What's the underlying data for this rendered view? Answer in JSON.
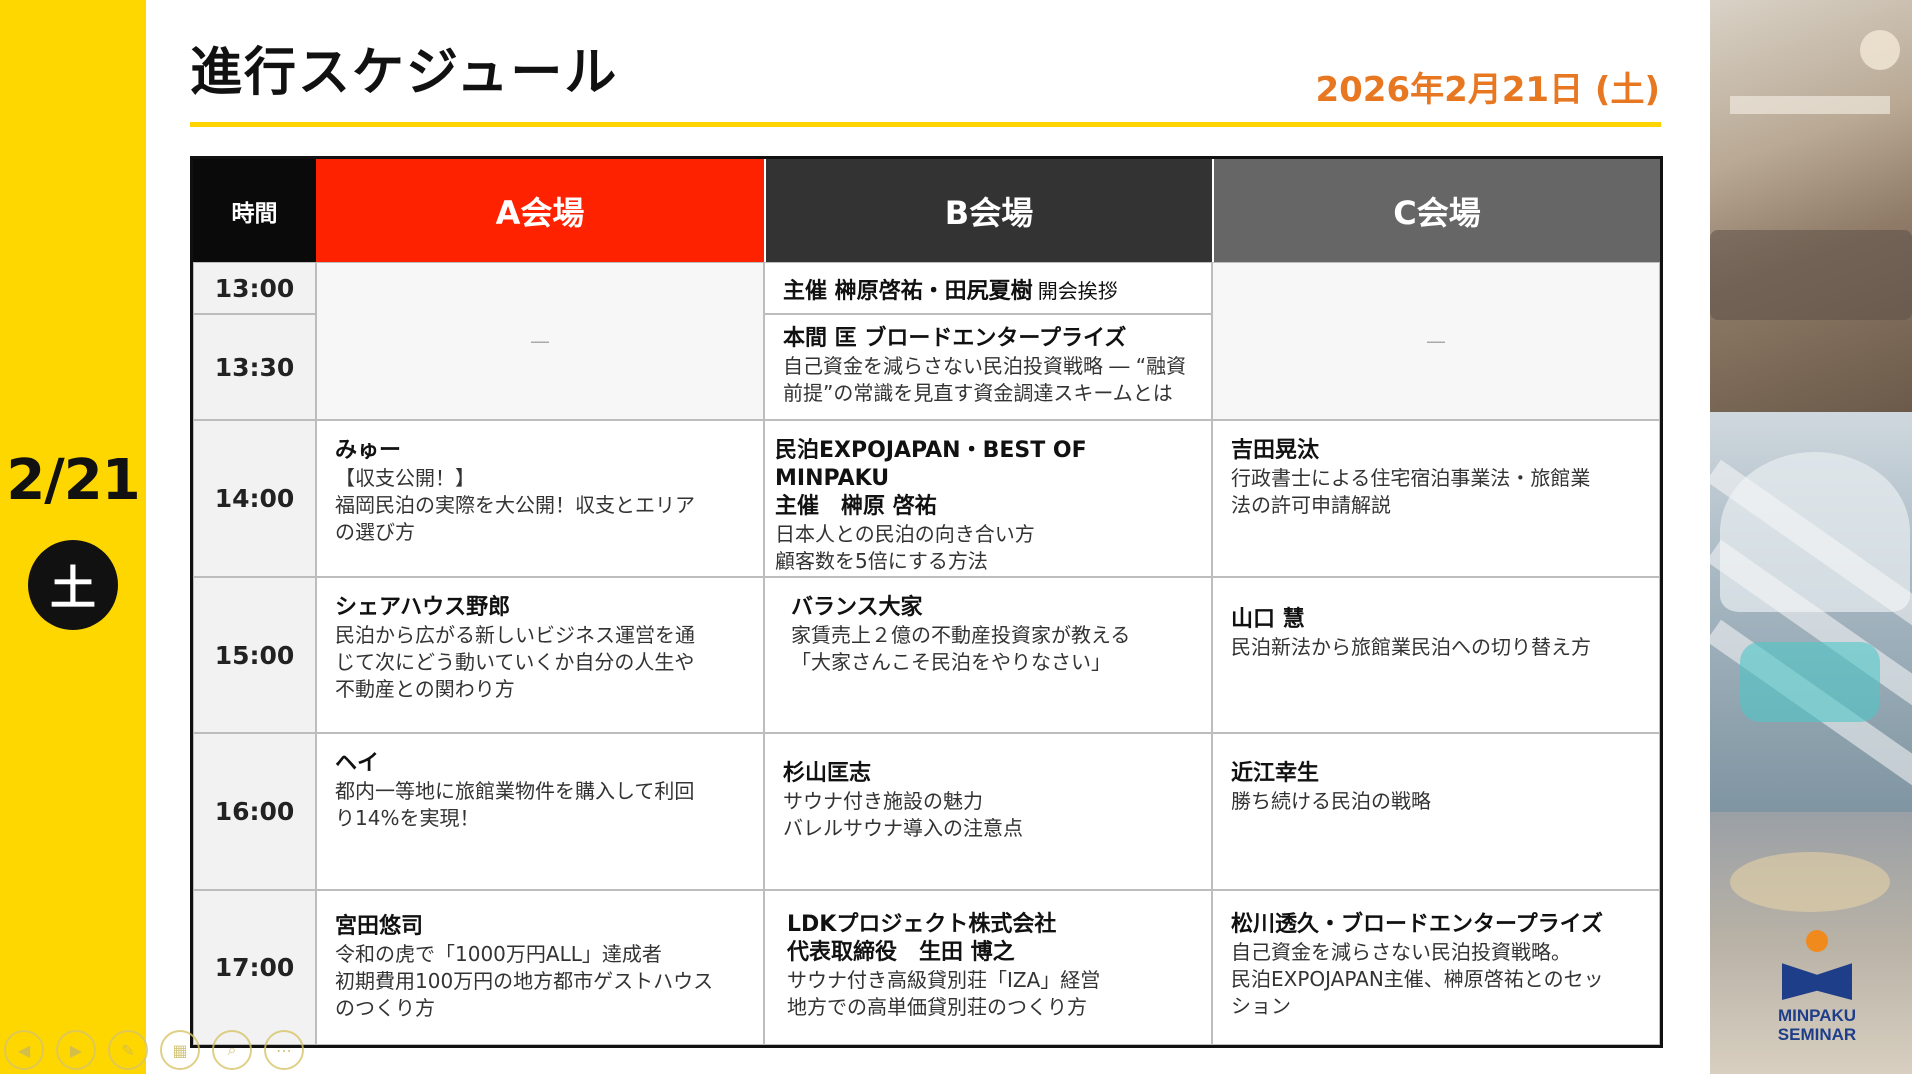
{
  "sidebar": {
    "date": "2/21",
    "day": "土"
  },
  "header": {
    "title": "進行スケジュール",
    "date": "2026年2月21日 (土)"
  },
  "table": {
    "headers": {
      "time": "時間",
      "venue_a": "A会場",
      "venue_b": "B会場",
      "venue_c": "C会場"
    },
    "times": [
      "13:00",
      "13:30",
      "14:00",
      "15:00",
      "16:00",
      "17:00"
    ],
    "empty_a": "—",
    "empty_c": "—",
    "b_1300": {
      "speaker": "主催 榊原啓祐・田尻夏樹",
      "note": "開会挨拶"
    },
    "b_1330": {
      "speaker": "本間 匡 ブロードエンタープライズ",
      "desc1": "自己資金を減らさない民泊投資戦略 ― “融資",
      "desc2": "前提”の常識を見直す資金調達スキームとは"
    },
    "row_1400": {
      "a": {
        "speaker": "みゅー",
        "desc1": "【収支公開！】",
        "desc2": "福岡民泊の実際を大公開！収支とエリア",
        "desc3": "の選び方"
      },
      "b": {
        "speaker1": "民泊EXPOJAPAN・BEST OF MINPAKU",
        "speaker2": "主催　榊原 啓祐",
        "desc1": "日本人との民泊の向き合い方",
        "desc2": "顧客数を5倍にする方法"
      },
      "c": {
        "speaker": "吉田晃汰",
        "desc1": "行政書士による住宅宿泊事業法・旅館業",
        "desc2": "法の許可申請解説"
      }
    },
    "row_1500": {
      "a": {
        "speaker": "シェアハウス野郎",
        "desc1": "民泊から広がる新しいビジネス運営を通",
        "desc2": "じて次にどう動いていくか自分の人生や",
        "desc3": "不動産との関わり方"
      },
      "b": {
        "speaker": "バランス大家",
        "desc1": "家賃売上２億の不動産投資家が教える",
        "desc2": "「大家さんこそ民泊をやりなさい」"
      },
      "c": {
        "speaker": "山口 慧",
        "desc1": "民泊新法から旅館業民泊への切り替え方"
      }
    },
    "row_1600": {
      "a": {
        "speaker": "ヘイ",
        "desc1": "都内一等地に旅館業物件を購入して利回",
        "desc2": "り14%を実現！"
      },
      "b": {
        "speaker": "杉山匡志",
        "desc1": "サウナ付き施設の魅力",
        "desc2": "バレルサウナ導入の注意点"
      },
      "c": {
        "speaker": "近江幸生",
        "desc1": "勝ち続ける民泊の戦略"
      }
    },
    "row_1700": {
      "a": {
        "speaker": "宮田悠司",
        "desc1": "令和の虎で「1000万円ALL」達成者",
        "desc2": "初期費用100万円の地方都市ゲストハウス",
        "desc3": "のつくり方"
      },
      "b": {
        "speaker1": "LDKプロジェクト株式会社",
        "speaker2": "代表取締役　生田 博之",
        "desc1": "サウナ付き高級貸別荘「IZA」経営",
        "desc2": "地方での高単価貸別荘のつくり方"
      },
      "c": {
        "speaker": "松川透久・ブロードエンタープライズ",
        "desc1": "自己資金を減らさない民泊投資戦略。",
        "desc2": "民泊EXPOJAPAN主催、榊原啓祐とのセッ",
        "desc3": "ション"
      }
    }
  },
  "logo": {
    "line1": "MINPAKU",
    "line2": "SEMINAR"
  },
  "toolbar": [
    "previous-icon",
    "next-icon",
    "pen-icon",
    "slides-icon",
    "zoom-icon",
    "more-icon"
  ],
  "colors": {
    "yellow": "#FFD700",
    "venue_a": "#FF2200",
    "venue_b": "#333333",
    "venue_c": "#666666",
    "date_accent": "#E87722",
    "logo_blue": "#1F3E8A"
  }
}
